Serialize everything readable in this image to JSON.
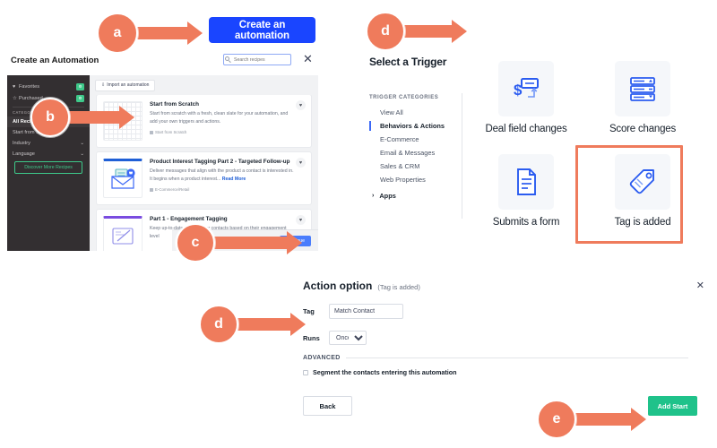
{
  "annotations": [
    {
      "id": "a",
      "label": "a"
    },
    {
      "id": "b",
      "label": "b"
    },
    {
      "id": "c",
      "label": "c"
    },
    {
      "id": "d1",
      "label": "d"
    },
    {
      "id": "d2",
      "label": "d"
    },
    {
      "id": "e",
      "label": "e"
    }
  ],
  "top": {
    "create_automation_label": "Create an automation"
  },
  "modal": {
    "title": "Create an Automation",
    "search_placeholder": "Search recipes",
    "close_label": "✕",
    "import_label": "Import an automation",
    "import_icon": "upload-icon",
    "continue_label": "Continue",
    "sidebar": {
      "quick_items": [
        {
          "label": "Favorites",
          "icon": "heart-icon",
          "badge": "⚙"
        },
        {
          "label": "Purchased",
          "icon": "tag-icon",
          "badge": "⚙"
        }
      ],
      "categories_header": "CATEGORIES",
      "categories": [
        {
          "label": "All Recipes",
          "active": true,
          "chevron": ""
        },
        {
          "label": "Start from Scratch",
          "active": false,
          "chevron": ""
        },
        {
          "label": "Industry",
          "active": false,
          "chevron": "⌄"
        },
        {
          "label": "Language",
          "active": false,
          "chevron": "⌄"
        }
      ],
      "discover_label": "Discover More Recipes"
    },
    "recipes": [
      {
        "title": "Start from Scratch",
        "description": "Start from scratch with a fresh, clean slate for your automation, and add your own triggers and actions.",
        "read_more": "",
        "tag": "Start from Scratch",
        "thumb": "grid-thumbnail",
        "favorite_icon": "heart-icon"
      },
      {
        "title": "Product Interest Tagging Part 2 - Targeted Follow-up",
        "description": "Deliver messages that align with the product a contact is interested in. It begins when a product interest...",
        "read_more": "Read More",
        "tag": "E-Commerce/Retail",
        "thumb": "envelope-thumbnail",
        "favorite_icon": "heart-icon"
      },
      {
        "title": "Part 1 - Engagement Tagging",
        "description": "Keep up-to-date tags on your contacts based on their engagement level",
        "read_more": "",
        "tag": "",
        "thumb": "document-thumbnail",
        "favorite_icon": "heart-icon"
      }
    ]
  },
  "trigger": {
    "title": "Select a Trigger",
    "categories_header": "TRIGGER CATEGORIES",
    "categories": [
      {
        "label": "View All",
        "active": false
      },
      {
        "label": "Behaviors & Actions",
        "active": true
      },
      {
        "label": "E-Commerce",
        "active": false
      },
      {
        "label": "Email & Messages",
        "active": false
      },
      {
        "label": "Sales & CRM",
        "active": false
      },
      {
        "label": "Web Properties",
        "active": false
      }
    ],
    "apps_label": "Apps",
    "apps_chevron": "›",
    "items": [
      {
        "label": "Deal field changes",
        "icon": "deal-field-icon",
        "selected": false
      },
      {
        "label": "Score changes",
        "icon": "score-changes-icon",
        "selected": false
      },
      {
        "label": "Submits a form",
        "icon": "form-icon",
        "selected": false
      },
      {
        "label": "Tag is added",
        "icon": "tag-icon",
        "selected": true
      }
    ]
  },
  "action": {
    "title": "Action option",
    "subtitle": "(Tag is added)",
    "close_label": "✕",
    "tag_label": "Tag",
    "tag_value": "Match Contact",
    "runs_label": "Runs",
    "runs_value": "Once",
    "runs_options": [
      "Once"
    ],
    "advanced_label": "ADVANCED",
    "segment_label": "Segment the contacts entering this automation",
    "segment_checked": false,
    "back_label": "Back",
    "add_start_label": "Add Start"
  },
  "colors": {
    "annotation": "#ef7b5c",
    "primary_blue": "#1a45ff",
    "continue_blue": "#4a7dfc",
    "sidebar_dark": "#332f31",
    "green": "#3ec98a",
    "add_start_green": "#1fc28a",
    "trigger_blue": "#3b68f6"
  }
}
